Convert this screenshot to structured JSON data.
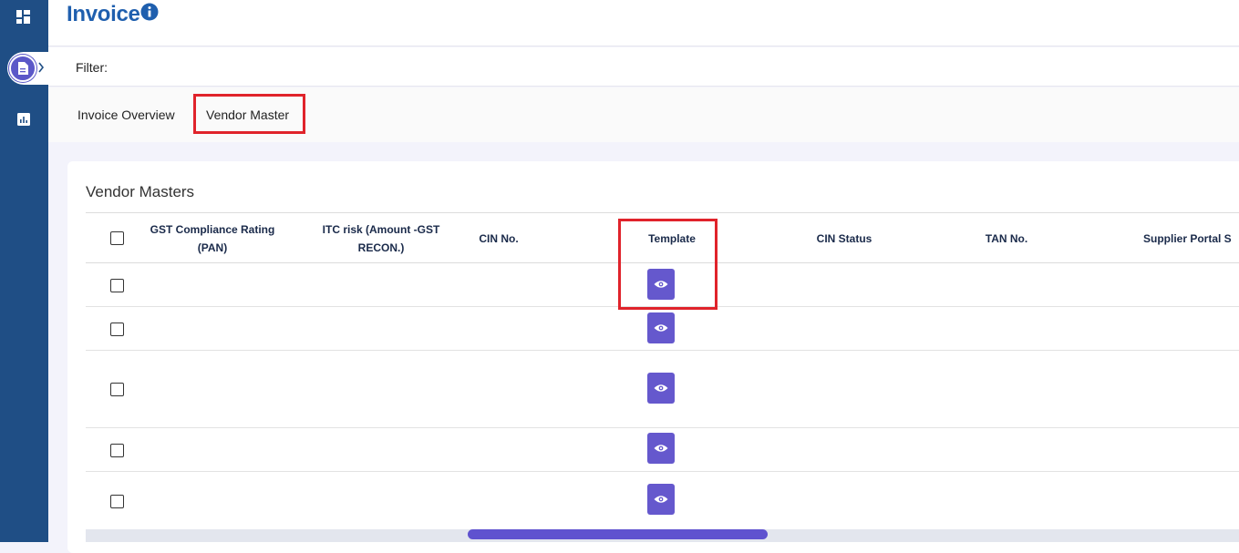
{
  "sidebar": {
    "icons": [
      "dashboard-icon",
      "document-icon",
      "chart-icon"
    ],
    "active_chevron": "chevron-right-icon"
  },
  "header": {
    "title": "Invoice",
    "info_icon": "info-icon"
  },
  "filter": {
    "label": "Filter:"
  },
  "tabs": [
    {
      "label": "Invoice Overview",
      "active": false
    },
    {
      "label": "Vendor Master",
      "active": true
    }
  ],
  "card": {
    "title": "Vendor Masters"
  },
  "table": {
    "columns": [
      {
        "label": "GST Compliance Rating (PAN)"
      },
      {
        "label": "ITC risk (Amount -GST RECON.)"
      },
      {
        "label": "CIN No."
      },
      {
        "label": "Template"
      },
      {
        "label": "CIN Status"
      },
      {
        "label": "TAN No."
      },
      {
        "label": "Supplier Portal S"
      }
    ],
    "rows": [
      {
        "template_action": "view-icon"
      },
      {
        "template_action": "view-icon"
      },
      {
        "template_action": "view-icon"
      },
      {
        "template_action": "view-icon"
      },
      {
        "template_action": "view-icon"
      }
    ]
  },
  "colors": {
    "sidebar": "#1f4e85",
    "accent": "#6558cd",
    "title": "#1f5fae",
    "highlight": "#e0232b"
  }
}
